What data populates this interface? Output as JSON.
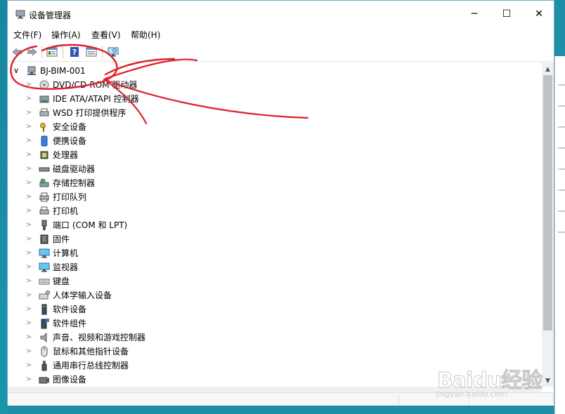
{
  "window": {
    "title": "设备管理器",
    "minimize_glyph": "─",
    "maximize_glyph": "☐",
    "close_glyph": "✕"
  },
  "menu": [
    {
      "label": "文件(F)"
    },
    {
      "label": "操作(A)"
    },
    {
      "label": "查看(V)"
    },
    {
      "label": "帮助(H)"
    }
  ],
  "toolbar_icons": [
    "back-arrow-icon",
    "forward-arrow-icon",
    "properties-icon",
    "help-icon",
    "details-view-icon",
    "monitor-scan-icon"
  ],
  "tree": {
    "root_label": "BJ-BIM-001",
    "root_chevron": "∨",
    "collapsed_chevron": ">",
    "items": [
      {
        "label": "DVD/CD-ROM 驱动器",
        "icon": "dvd-drive-icon"
      },
      {
        "label": "IDE ATA/ATAPI 控制器",
        "icon": "ide-controller-icon"
      },
      {
        "label": "WSD 打印提供程序",
        "icon": "wsd-printer-icon"
      },
      {
        "label": "安全设备",
        "icon": "security-key-icon"
      },
      {
        "label": "便携设备",
        "icon": "portable-device-icon"
      },
      {
        "label": "处理器",
        "icon": "processor-icon"
      },
      {
        "label": "磁盘驱动器",
        "icon": "disk-drive-icon"
      },
      {
        "label": "存储控制器",
        "icon": "storage-controller-icon"
      },
      {
        "label": "打印队列",
        "icon": "print-queue-icon"
      },
      {
        "label": "打印机",
        "icon": "printer-icon"
      },
      {
        "label": "端口 (COM 和 LPT)",
        "icon": "port-icon"
      },
      {
        "label": "固件",
        "icon": "firmware-icon"
      },
      {
        "label": "计算机",
        "icon": "computer-icon"
      },
      {
        "label": "监视器",
        "icon": "monitor-icon"
      },
      {
        "label": "键盘",
        "icon": "keyboard-icon"
      },
      {
        "label": "人体学输入设备",
        "icon": "hid-icon"
      },
      {
        "label": "软件设备",
        "icon": "software-device-icon"
      },
      {
        "label": "软件组件",
        "icon": "software-component-icon"
      },
      {
        "label": "声音、视频和游戏控制器",
        "icon": "speaker-icon"
      },
      {
        "label": "鼠标和其他指针设备",
        "icon": "mouse-icon"
      },
      {
        "label": "通用串行总线控制器",
        "icon": "usb-icon"
      },
      {
        "label": "图像设备",
        "icon": "camera-icon"
      }
    ]
  },
  "scroll": {
    "up_glyph": "▲",
    "down_glyph": "▼"
  },
  "watermark": {
    "brand": "Baidu经验",
    "url": "jingyan.baidu.com"
  },
  "colors": {
    "annotation_red": "#e0202a",
    "desktop": "#1e8fa6",
    "selection_blue": "#2b78c5"
  }
}
